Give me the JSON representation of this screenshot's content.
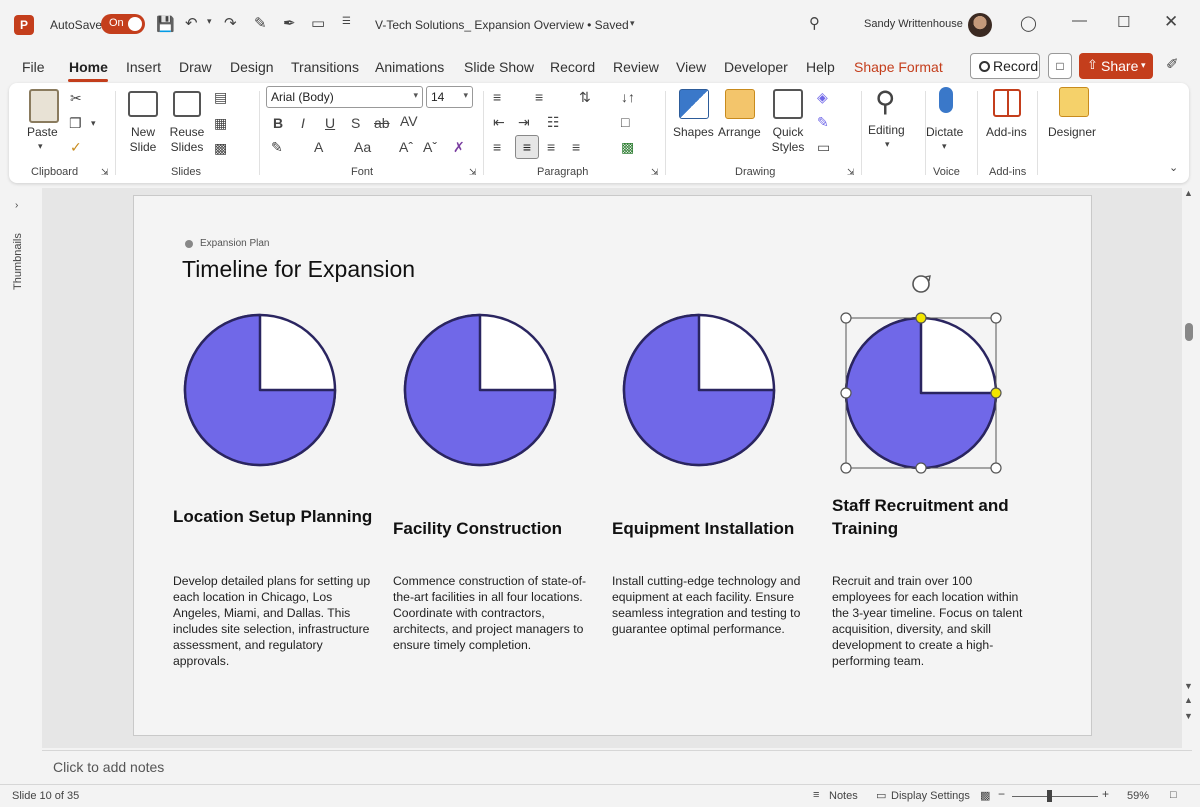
{
  "titlebar": {
    "autosave_label": "AutoSave",
    "autosave_state": "On",
    "doc_title": "V-Tech Solutions_ Expansion Overview • Saved",
    "user_name": "Sandy Writtenhouse",
    "accent": "#c43e1c"
  },
  "tabs": [
    "File",
    "Home",
    "Insert",
    "Draw",
    "Design",
    "Transitions",
    "Animations",
    "Slide Show",
    "Record",
    "Review",
    "View",
    "Developer",
    "Help",
    "Shape Format"
  ],
  "active_tab": "Home",
  "ribbon": {
    "record_label": "Record",
    "share_label": "Share",
    "clipboard": {
      "paste": "Paste",
      "group": "Clipboard"
    },
    "slides": {
      "new_slide": "New Slide",
      "reuse_slides": "Reuse Slides",
      "group": "Slides"
    },
    "font": {
      "font_name": "Arial (Body)",
      "font_size": "14",
      "group": "Font"
    },
    "paragraph": {
      "group": "Paragraph"
    },
    "drawing": {
      "shapes": "Shapes",
      "arrange": "Arrange",
      "quick_styles": "Quick Styles",
      "group": "Drawing"
    },
    "editing": {
      "label": "Editing"
    },
    "voice": {
      "dictate": "Dictate",
      "group": "Voice"
    },
    "addins": {
      "label": "Add-ins",
      "group": "Add-ins"
    },
    "designer": {
      "label": "Designer"
    }
  },
  "side_panel": {
    "thumbnails_label": "Thumbnails"
  },
  "slide": {
    "kicker": "Expansion Plan",
    "title": "Timeline for Expansion",
    "pie_color": "#7068e8",
    "pie_outline": "#2a2560",
    "pie_fraction_filled": 0.75,
    "steps": [
      {
        "title": "Location Setup Planning",
        "body": "Develop detailed plans for setting up each location in Chicago, Los Angeles, Miami, and Dallas. This includes site selection, infrastructure assessment, and regulatory approvals."
      },
      {
        "title": "Facility Construction",
        "body": "Commence construction of state-of-the-art facilities in all four locations. Coordinate with contractors, architects, and project managers to ensure timely completion."
      },
      {
        "title": "Equipment Installation",
        "body": "Install cutting-edge technology and equipment at each facility. Ensure seamless integration and testing to guarantee optimal performance."
      },
      {
        "title": "Staff Recruitment and Training",
        "body": "Recruit and train over 100 employees for each location within the 3-year timeline. Focus on talent acquisition, diversity, and skill development to create a high-performing team."
      }
    ]
  },
  "notes": {
    "placeholder": "Click to add notes"
  },
  "statusbar": {
    "slide_counter": "Slide 10 of 35",
    "notes": "Notes",
    "display_settings": "Display Settings",
    "zoom": "59%"
  }
}
